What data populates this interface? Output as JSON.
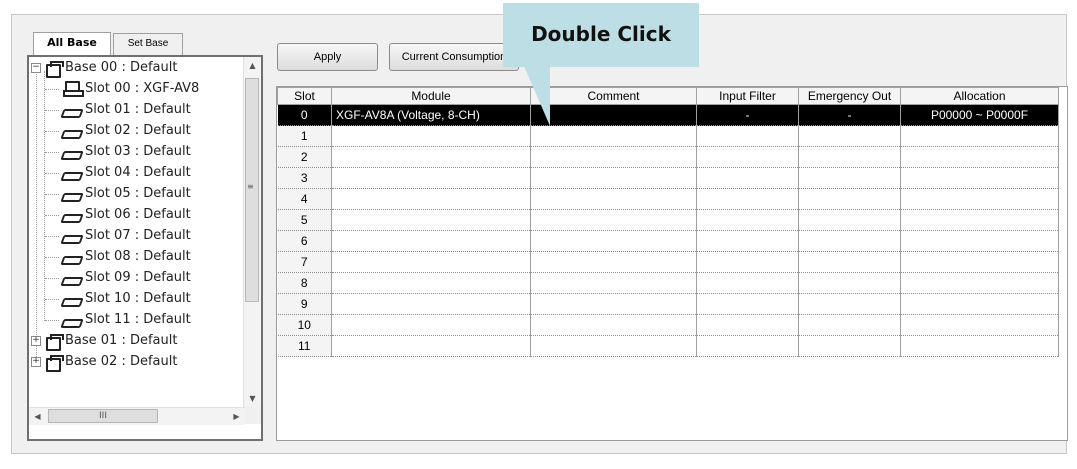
{
  "tabs": [
    {
      "label": "All Base",
      "active": true
    },
    {
      "label": "Set Base",
      "active": false
    }
  ],
  "tree": {
    "nodes": [
      {
        "kind": "base",
        "label": "Base 00 : Default",
        "expander": "−"
      },
      {
        "kind": "module",
        "label": "Slot 00 : XGF-AV8"
      },
      {
        "kind": "slot",
        "label": "Slot 01 : Default"
      },
      {
        "kind": "slot",
        "label": "Slot 02 : Default"
      },
      {
        "kind": "slot",
        "label": "Slot 03 : Default"
      },
      {
        "kind": "slot",
        "label": "Slot 04 : Default"
      },
      {
        "kind": "slot",
        "label": "Slot 05 : Default"
      },
      {
        "kind": "slot",
        "label": "Slot 06 : Default"
      },
      {
        "kind": "slot",
        "label": "Slot 07 : Default"
      },
      {
        "kind": "slot",
        "label": "Slot 08 : Default"
      },
      {
        "kind": "slot",
        "label": "Slot 09 : Default"
      },
      {
        "kind": "slot",
        "label": "Slot 10 : Default"
      },
      {
        "kind": "slot",
        "label": "Slot 11 : Default"
      },
      {
        "kind": "base",
        "label": "Base 01 : Default",
        "expander": "+"
      },
      {
        "kind": "base",
        "label": "Base 02 : Default",
        "expander": "+"
      }
    ]
  },
  "toolbar": {
    "apply_label": "Apply",
    "current_consumption_label": "Current Consumption"
  },
  "callout": {
    "text": "Double Click",
    "color": "#bddee5"
  },
  "grid": {
    "columns": [
      "Slot",
      "Module",
      "Comment",
      "Input Filter",
      "Emergency Out",
      "Allocation"
    ],
    "rows": [
      {
        "slot": "0",
        "module": "XGF-AV8A (Voltage, 8-CH)",
        "comment": "",
        "input_filter": "-",
        "emergency_out": "-",
        "allocation": "P00000 ~ P0000F",
        "selected": true
      },
      {
        "slot": "1",
        "module": "",
        "comment": "",
        "input_filter": "",
        "emergency_out": "",
        "allocation": ""
      },
      {
        "slot": "2",
        "module": "",
        "comment": "",
        "input_filter": "",
        "emergency_out": "",
        "allocation": ""
      },
      {
        "slot": "3",
        "module": "",
        "comment": "",
        "input_filter": "",
        "emergency_out": "",
        "allocation": ""
      },
      {
        "slot": "4",
        "module": "",
        "comment": "",
        "input_filter": "",
        "emergency_out": "",
        "allocation": ""
      },
      {
        "slot": "5",
        "module": "",
        "comment": "",
        "input_filter": "",
        "emergency_out": "",
        "allocation": ""
      },
      {
        "slot": "6",
        "module": "",
        "comment": "",
        "input_filter": "",
        "emergency_out": "",
        "allocation": ""
      },
      {
        "slot": "7",
        "module": "",
        "comment": "",
        "input_filter": "",
        "emergency_out": "",
        "allocation": ""
      },
      {
        "slot": "8",
        "module": "",
        "comment": "",
        "input_filter": "",
        "emergency_out": "",
        "allocation": ""
      },
      {
        "slot": "9",
        "module": "",
        "comment": "",
        "input_filter": "",
        "emergency_out": "",
        "allocation": ""
      },
      {
        "slot": "10",
        "module": "",
        "comment": "",
        "input_filter": "",
        "emergency_out": "",
        "allocation": ""
      },
      {
        "slot": "11",
        "module": "",
        "comment": "",
        "input_filter": "",
        "emergency_out": "",
        "allocation": ""
      }
    ]
  },
  "scrollbar": {
    "h_thumb_glyph": "III"
  }
}
